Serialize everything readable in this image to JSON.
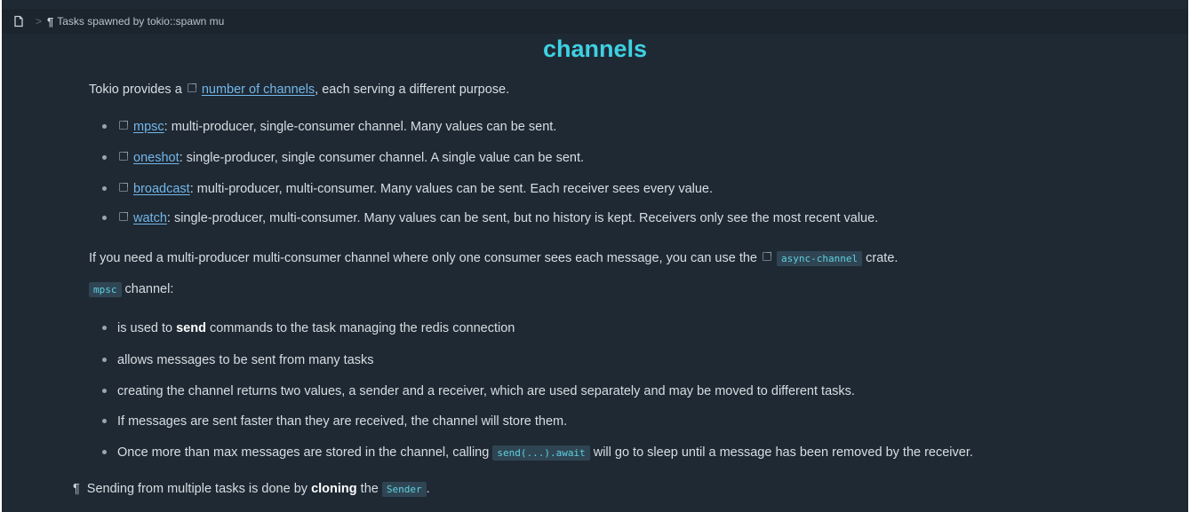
{
  "breadcrumb": {
    "separator": ">",
    "paragraph_symbol": "¶",
    "current": "Tasks spawned by tokio::spawn mu"
  },
  "title": "channels",
  "intro": {
    "prefix": "Tokio provides a",
    "link": "number of channels",
    "suffix": ", each serving a different purpose."
  },
  "channel_types": [
    {
      "link": "mpsc",
      "text": ": multi-producer, single-consumer channel. Many values can be sent."
    },
    {
      "link": "oneshot",
      "text": ": single-producer, single consumer channel. A single value can be sent."
    },
    {
      "link": "broadcast",
      "text": ": multi-producer, multi-consumer. Many values can be sent. Each receiver sees every value."
    },
    {
      "link": "watch",
      "text": ": single-producer, multi-consumer. Many values can be sent, but no history is kept. Receivers only see the most recent value."
    }
  ],
  "async_note": {
    "prefix": "If you need a multi-producer multi-consumer channel where only one consumer sees each message, you can use the",
    "code": "async-channel",
    "suffix": "crate."
  },
  "mpsc_heading": {
    "code": "mpsc",
    "text": "channel:"
  },
  "mpsc_points": {
    "p1": {
      "prefix": "is used to",
      "bold": "send",
      "suffix": "commands to the task managing the redis connection"
    },
    "p2": "allows messages to be sent from many tasks",
    "p3": "creating the channel returns two values, a sender and a receiver, which are used separately and may be moved to different tasks.",
    "p4": "If messages are sent faster than they are received, the channel will store them.",
    "p5": {
      "prefix": "Once more than max messages are stored in the channel, calling",
      "code": "send(...).await",
      "suffix": "will go to sleep until a message has been removed by the receiver."
    }
  },
  "footer": {
    "pilcrow": "¶",
    "prefix": "Sending from multiple tasks is done by",
    "bold": "cloning",
    "mid": "the",
    "code": "Sender",
    "suffix": "."
  }
}
